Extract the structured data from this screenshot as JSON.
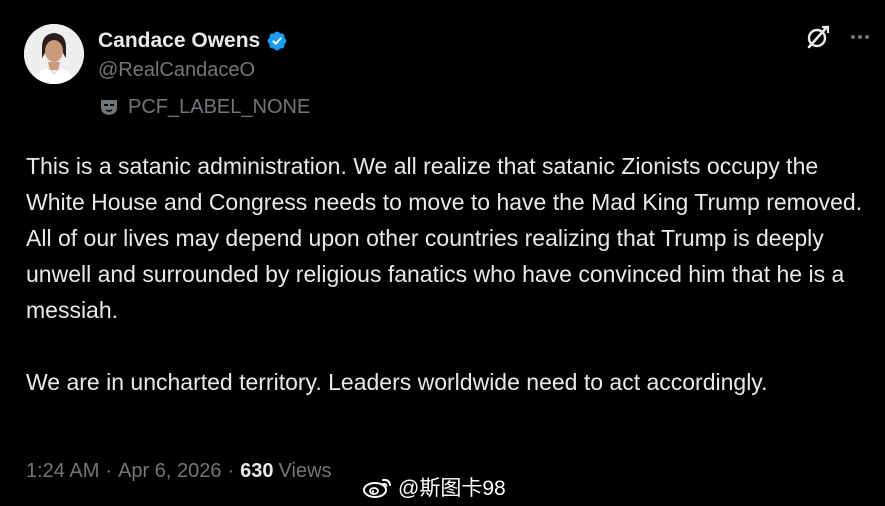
{
  "author": {
    "display_name": "Candace Owens",
    "handle": "@RealCandaceO",
    "verified": true,
    "label": "PCF_LABEL_NONE"
  },
  "actions": {
    "grok_icon": "grok-icon",
    "more_icon": "more-icon"
  },
  "tweet": {
    "paragraphs": [
      "This is a satanic administration. We all realize that satanic Zionists occupy the White House and Congress needs to move to have the Mad King Trump removed.",
      "All of our lives may depend upon other countries realizing that Trump is deeply unwell and surrounded by religious fanatics who have convinced him that he is a messiah.",
      "We are in uncharted territory. Leaders worldwide need to act accordingly."
    ]
  },
  "meta": {
    "time": "1:24 AM",
    "separator": "·",
    "date": "Apr 6, 2026",
    "views_count": "630",
    "views_label": "Views"
  },
  "watermark": {
    "text": "@斯图卡98"
  },
  "colors": {
    "background": "#000000",
    "primary_text": "#e7e9ea",
    "secondary_text": "#71767b",
    "verified_blue": "#1d9bf0"
  }
}
